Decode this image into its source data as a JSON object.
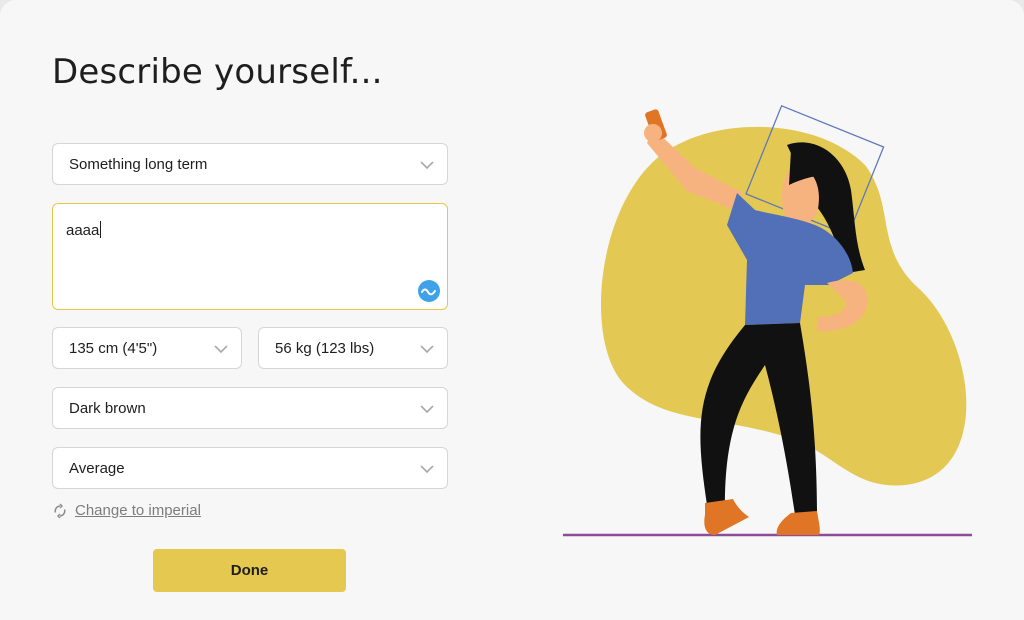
{
  "page": {
    "title": "Describe yourself..."
  },
  "form": {
    "relationship": {
      "value": "Something long term"
    },
    "about": {
      "value": "aaaa"
    },
    "height": {
      "value": "135 cm (4'5\")"
    },
    "weight": {
      "value": "56 kg (123 lbs)"
    },
    "hair_color": {
      "value": "Dark brown"
    },
    "body_type": {
      "value": "Average"
    }
  },
  "units_toggle": {
    "label": "Change to imperial"
  },
  "actions": {
    "done_label": "Done"
  },
  "colors": {
    "accent": "#e5c84f",
    "blob": "#e3c853",
    "shirt": "#5170b7",
    "skin": "#f7b37f",
    "shoes": "#e07526",
    "ground_line": "#8a4d96",
    "grammar_icon": "#3fa2e8"
  },
  "icons": {
    "select_chevron": "chevron-down-icon",
    "grammar": "grammar-check-icon",
    "toggle": "refresh-icon"
  }
}
